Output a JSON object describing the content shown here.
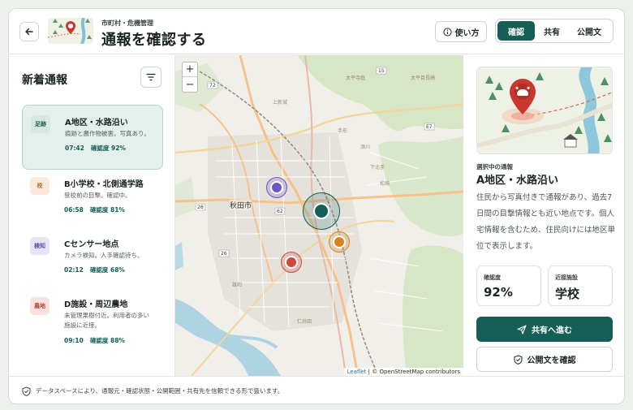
{
  "header": {
    "eyebrow": "市町村・危機管理",
    "title": "通報を確認する",
    "help_label": "使い方",
    "tabs": [
      "確認",
      "共有",
      "公開文"
    ],
    "active_tab": "確認"
  },
  "sidebar": {
    "title": "新着通報",
    "reports": [
      {
        "badge": "足跡",
        "title": "A地区・水路沿い",
        "desc": "痕跡と農作物被害。写真あり。",
        "time": "07:42",
        "confidence": "確認度 92%",
        "badge_bg": "#d7e8e2",
        "badge_fg": "#155f56",
        "active": true
      },
      {
        "badge": "校",
        "title": "B小学校・北側通学路",
        "desc": "登校前の目撃。確認中。",
        "time": "06:58",
        "confidence": "確認度 81%",
        "badge_bg": "#fbeadb",
        "badge_fg": "#b46a2a"
      },
      {
        "badge": "検知",
        "title": "Cセンサー地点",
        "desc": "カメラ検知。人手確認待ち。",
        "time": "02:12",
        "confidence": "確認度 68%",
        "badge_bg": "#e7e4f6",
        "badge_fg": "#5b4fb0"
      },
      {
        "badge": "農地",
        "title": "D施設・周辺農地",
        "desc": "未管理果樹付近。利用者の多い施設に近接。",
        "time": "09:10",
        "confidence": "確認度 88%",
        "badge_bg": "#f8e1de",
        "badge_fg": "#b6463a"
      }
    ]
  },
  "map": {
    "zoom_in": "+",
    "zoom_out": "−",
    "city_label": "秋田市",
    "attribution_leaflet": "Leaflet",
    "attribution_osm": "| © OpenStreetMap contributors",
    "colors": {
      "purple": "#6c55c8",
      "teal": "#155f56",
      "orange": "#d9831c",
      "red": "#cc4b3e"
    }
  },
  "detail": {
    "label": "選択中の通報",
    "title": "A地区・水路沿い",
    "desc": "住民から写真付きで通報があり、過去7日間の目撃情報とも近い地点です。個人宅情報を含むため、住民向けには地区単位で表示します。",
    "stats": [
      {
        "label": "確認度",
        "value": "92%"
      },
      {
        "label": "近接施設",
        "value": "学校"
      }
    ],
    "primary_button": "共有へ進む",
    "secondary_button": "公開文を確認"
  },
  "footer": {
    "text": "データスペースにより、通報元・確認状態・公開範囲・共有先を信頼できる形で扱います。"
  }
}
